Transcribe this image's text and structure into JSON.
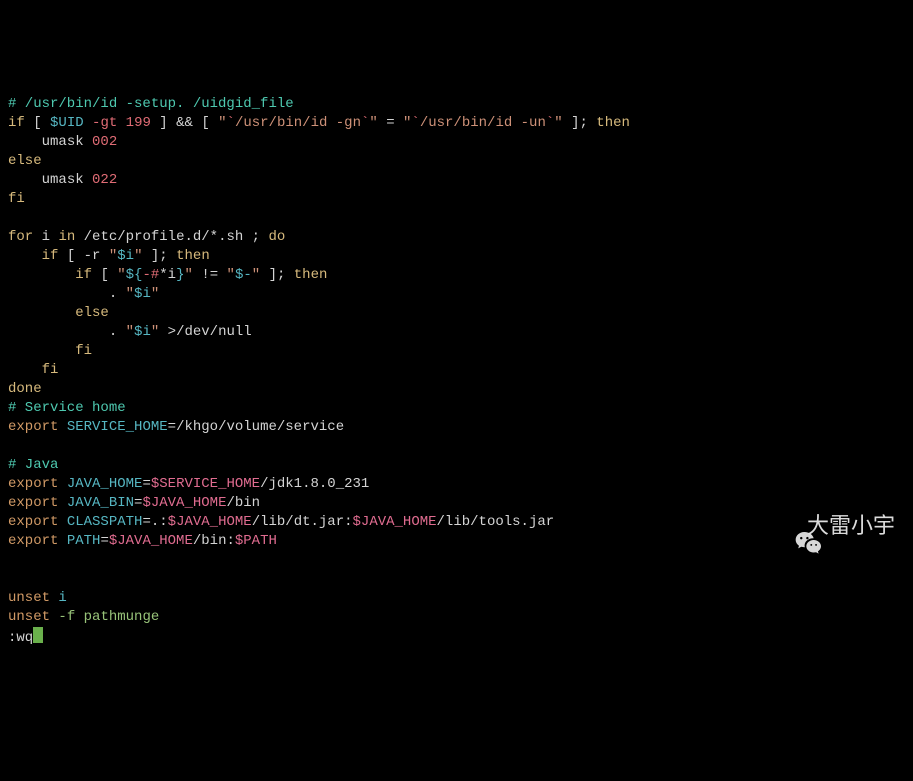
{
  "comment_header": "# /usr/bin/id -setup. /uidgid_file",
  "line_if_uid": {
    "if": "if",
    "lb": "[",
    "uid": "$UID",
    "gt": "-gt",
    "num": "199",
    "rb": "]",
    "and": "&&",
    "lb2": "[",
    "q1": "\"",
    "bt1": "`",
    "id_gn": "/usr/bin/id -gn",
    "q2": "\"",
    "eq": "=",
    "q3": "\"",
    "bt2": "`",
    "id_un": "/usr/bin/id -un",
    "q4": "\"",
    "rb2": "]",
    "then": "then"
  },
  "umask002": {
    "cmd": "umask",
    "val": "002"
  },
  "else_kw": "else",
  "umask022": {
    "cmd": "umask",
    "val": "022"
  },
  "fi_kw": "fi",
  "for_line": {
    "for": "for",
    "i": "i",
    "in": "in",
    "glob": "/etc/profile.d/*.sh ;",
    "do": "do"
  },
  "if_r_line": {
    "if": "if",
    "lb": "[",
    "flag": "-r",
    "q": "\"",
    "var": "$i",
    "rb": "]",
    "then": "then"
  },
  "if_flags_line": {
    "if": "if",
    "lb": "[",
    "q1": "\"",
    "open": "${",
    "hash": "-#",
    "star_i": "*i",
    "close": "}",
    "q2": "\"",
    "ne": "!=",
    "q3": "\"",
    "dash": "$-",
    "q4": "\"",
    "rb": "]",
    "then": "then"
  },
  "dot_source_1": {
    "dot": ".",
    "q": "\"",
    "var": "$i"
  },
  "else_kw2": "else",
  "dot_source_2": {
    "dot": ".",
    "q": "\"",
    "var": "$i",
    "redir": ">/dev/null"
  },
  "fi_kw2": "fi",
  "fi_kw3": "fi",
  "done_kw": "done",
  "service_home_comment": "# Service home",
  "export_service": {
    "exp": "export",
    "var": "SERVICE_HOME",
    "val": "/khgo/volume/service"
  },
  "java_comment": "# Java",
  "export_java_home": {
    "exp": "export",
    "var": "JAVA_HOME",
    "ref": "$SERVICE_HOME",
    "val": "/jdk1.8.0_231"
  },
  "export_java_bin": {
    "exp": "export",
    "var": "JAVA_BIN",
    "ref": "$JAVA_HOME",
    "val": "/bin"
  },
  "export_classpath": {
    "exp": "export",
    "var": "CLASSPATH",
    "pre": ".:",
    "ref1": "$JAVA_HOME",
    "mid": "/lib/dt.jar:",
    "ref2": "$JAVA_HOME",
    "end": "/lib/tools.jar"
  },
  "export_path": {
    "exp": "export",
    "var": "PATH",
    "ref1": "$JAVA_HOME",
    "mid": "/bin:",
    "ref2": "$PATH"
  },
  "unset_i": {
    "cmd": "unset",
    "var": "i"
  },
  "unset_pm": {
    "cmd": "unset",
    "flag": "-f",
    "name": "pathmunge"
  },
  "command_line": ":wq",
  "watermark_text": "大雷小宇"
}
